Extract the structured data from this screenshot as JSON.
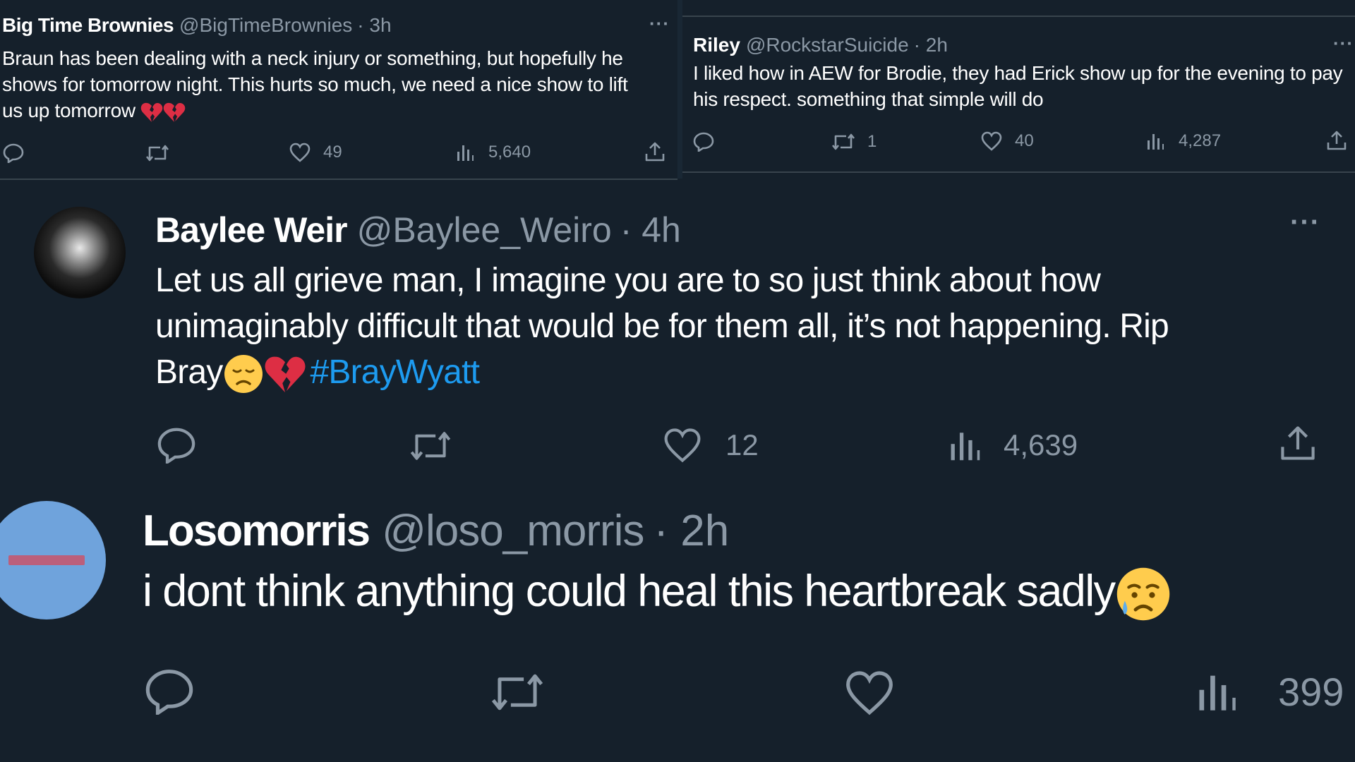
{
  "tweets": {
    "top_left": {
      "name": "Big Time Brownies",
      "handle": "@BigTimeBrownies",
      "time": "· 3h",
      "line1": "Braun has been dealing with a neck injury or something, but hopefully he",
      "line2": "shows for tomorrow night. This hurts so much, we need a nice show to lift",
      "line3": "us up tomorrow",
      "likes": "49",
      "views": "5,640"
    },
    "top_right": {
      "name": "Riley",
      "handle": "@RockstarSuicide",
      "time": "· 2h",
      "line1": "I liked how in AEW for Brodie, they had Erick show up for the evening to pay",
      "line2": "his respect. something that simple will do",
      "retweets": "1",
      "likes": "40",
      "views": "4,287"
    },
    "middle": {
      "name": "Baylee Weir",
      "handle": "@Baylee_Weiro",
      "time": "· 4h",
      "line1": "Let us all grieve man, I imagine you are to so just think about how",
      "line2": "unimaginably difficult that would be for them all, it’s not happening. Rip",
      "line3": "Bray",
      "hashtag": "#BrayWyatt",
      "likes": "12",
      "views": "4,639"
    },
    "bottom": {
      "name": "Losomorris",
      "handle": "@loso_morris",
      "time": "· 2h",
      "text": "i dont think anything could heal this heartbreak sadly",
      "views": "399"
    }
  },
  "colors": {
    "background": "#15202b",
    "text": "#ffffff",
    "muted": "#8b98a5",
    "link": "#1d9bf0",
    "divider": "#38444d"
  },
  "icons": [
    "reply-icon",
    "retweet-icon",
    "like-icon",
    "views-icon",
    "share-icon",
    "more-icon",
    "broken-heart-icon",
    "sad-face-icon"
  ]
}
